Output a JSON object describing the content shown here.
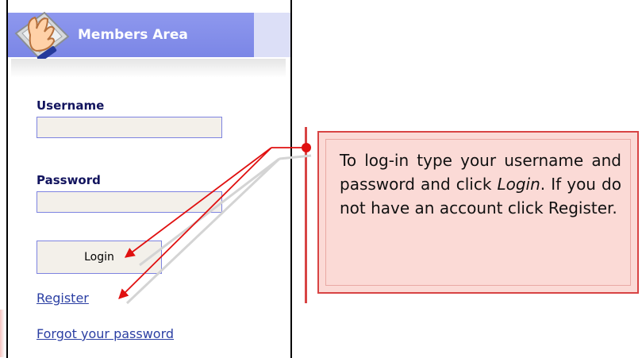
{
  "members": {
    "title": "Members Area",
    "username_label": "Username",
    "username_value": "",
    "password_label": "Password",
    "password_value": "",
    "login_label": "Login",
    "register_label": "Register",
    "forgot_label": "Forgot your password"
  },
  "callout": {
    "text_before": "To log-in type your username and password and click ",
    "emphasis": "Login",
    "text_after": ". If you do not have an account click Register."
  },
  "colors": {
    "header": "#8e98ee",
    "label": "#12145e",
    "link": "#2b3fa3",
    "callout_bg": "#fbdad6",
    "callout_border": "#d84444"
  },
  "icons": {
    "header": "hand-on-keyboard-icon",
    "annotation-dot": "dot-icon"
  }
}
